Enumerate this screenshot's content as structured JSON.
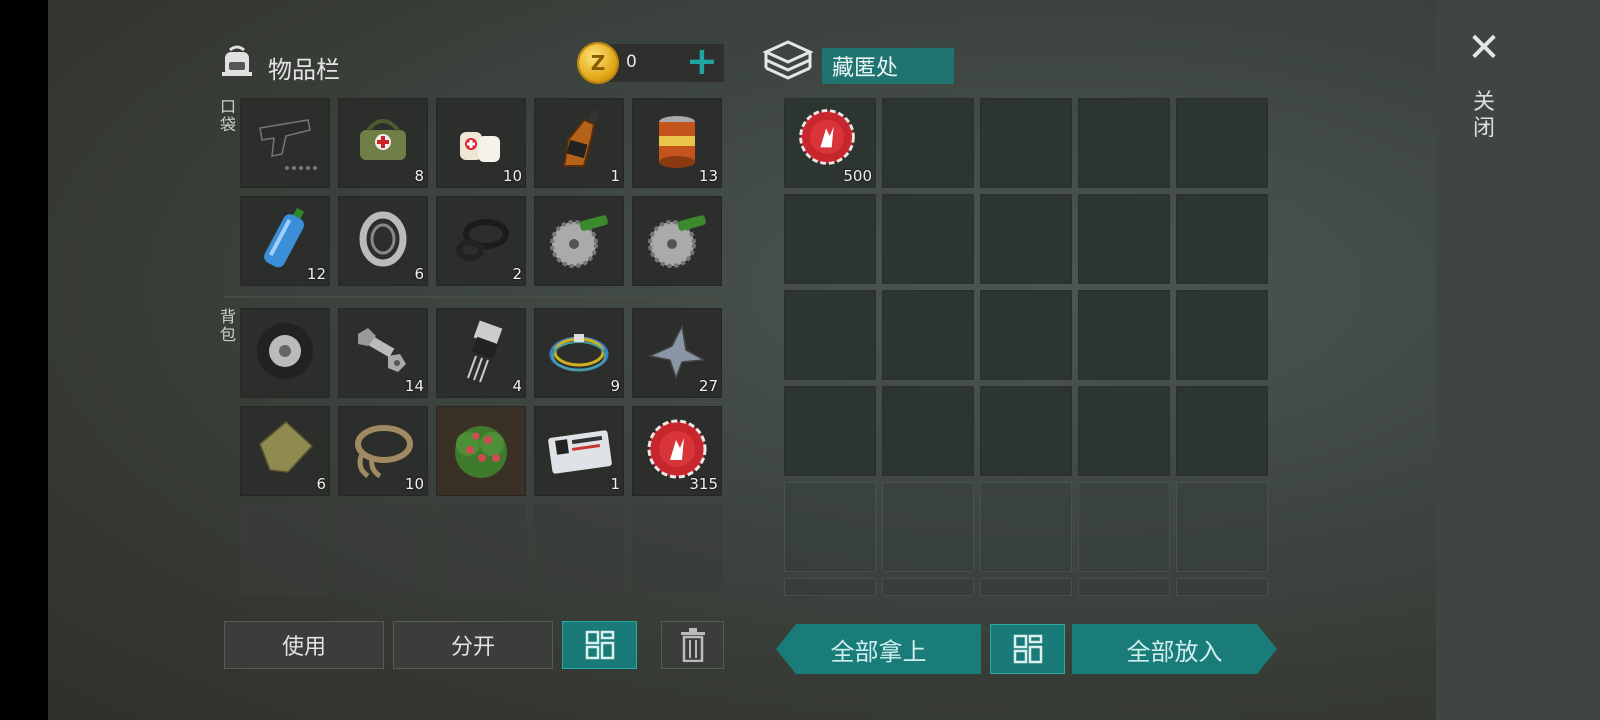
{
  "inventory": {
    "title": "物品栏",
    "currency_amount": "0",
    "pocket_label": "口袋",
    "backpack_label": "背包",
    "pocket_items": [
      {
        "name": "pistol",
        "count": ""
      },
      {
        "name": "medkit-bag",
        "count": "8"
      },
      {
        "name": "bandage",
        "count": "10"
      },
      {
        "name": "whiskey",
        "count": "1"
      },
      {
        "name": "food-can",
        "count": "13"
      },
      {
        "name": "water-bottle",
        "count": "12"
      },
      {
        "name": "bearing",
        "count": "6"
      },
      {
        "name": "rubber-seal",
        "count": "2"
      },
      {
        "name": "saw-blade",
        "count": ""
      },
      {
        "name": "saw-blade",
        "count": ""
      }
    ],
    "backpack_items": [
      {
        "name": "tire",
        "count": ""
      },
      {
        "name": "bolt-nut",
        "count": "14"
      },
      {
        "name": "transistor",
        "count": "4"
      },
      {
        "name": "wires",
        "count": "9"
      },
      {
        "name": "scrap-metal",
        "count": "27"
      },
      {
        "name": "cloth",
        "count": "6"
      },
      {
        "name": "rope",
        "count": "10"
      },
      {
        "name": "berry-bush",
        "count": ""
      },
      {
        "name": "army-card",
        "count": "1"
      },
      {
        "name": "bottle-cap",
        "count": "315"
      }
    ]
  },
  "stash": {
    "title": "藏匿处",
    "first_item_count": "500"
  },
  "buttons": {
    "use": "使用",
    "split": "分开",
    "take_all": "全部拿上",
    "put_all": "全部放入"
  },
  "close": {
    "label": "关闭"
  },
  "colors": {
    "accent": "#1f7471",
    "accent_bright": "#1fa6a2"
  }
}
